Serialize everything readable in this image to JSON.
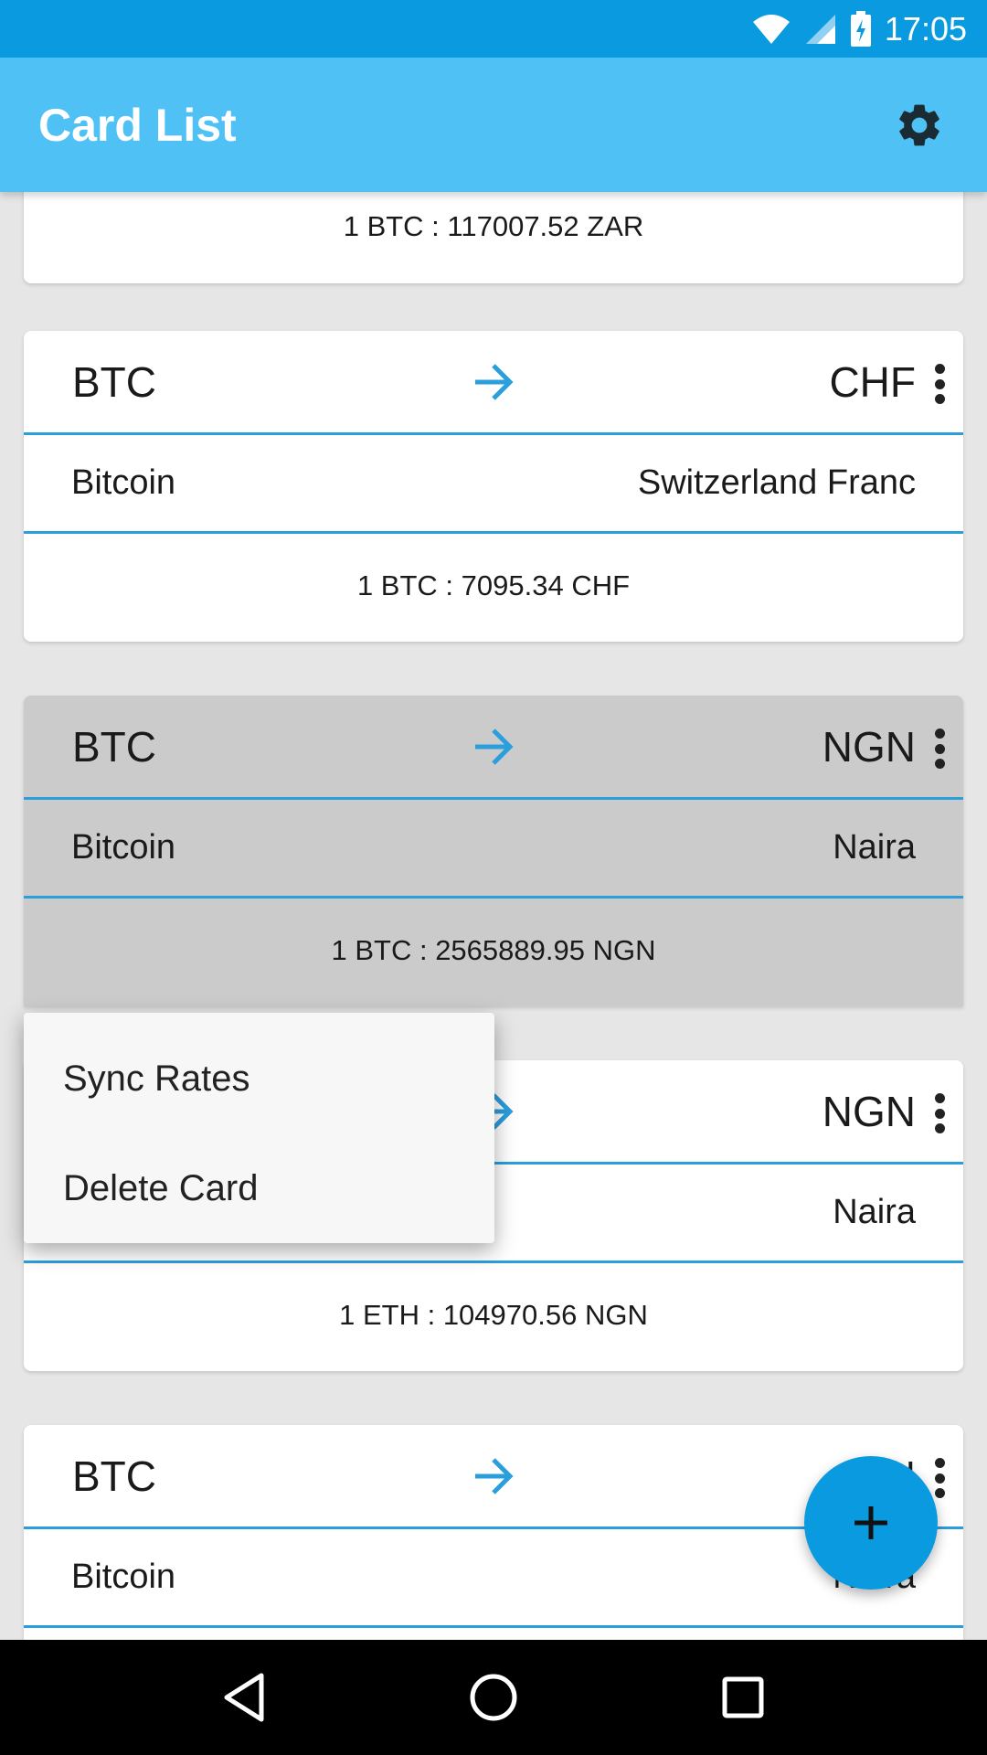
{
  "status_bar": {
    "time": "17:05"
  },
  "app_bar": {
    "title": "Card List"
  },
  "cards": [
    {
      "rate": "1 BTC : 117007.52 ZAR"
    },
    {
      "from_code": "BTC",
      "to_code": "CHF",
      "from_name": "Bitcoin",
      "to_name": "Switzerland Franc",
      "rate": "1 BTC : 7095.34 CHF"
    },
    {
      "from_code": "BTC",
      "to_code": "NGN",
      "from_name": "Bitcoin",
      "to_name": "Naira",
      "rate": "1 BTC : 2565889.95 NGN"
    },
    {
      "from_code": "",
      "to_code": "NGN",
      "from_name": "",
      "to_name": "Naira",
      "rate": "1 ETH : 104970.56 NGN"
    },
    {
      "from_code": "BTC",
      "to_code": "N",
      "from_name": "Bitcoin",
      "to_name": "Naira"
    }
  ],
  "popup_menu": {
    "items": [
      "Sync Rates",
      "Delete Card"
    ]
  },
  "colors": {
    "status_bar": "#0a9ae0",
    "app_bar": "#4fc1f5",
    "accent": "#2b9fdc",
    "fab": "#0a9ae0"
  },
  "icons": {
    "settings": "gear-icon",
    "arrow": "arrow-right-icon",
    "more": "more-vert-icon",
    "fab": "plus-icon"
  }
}
